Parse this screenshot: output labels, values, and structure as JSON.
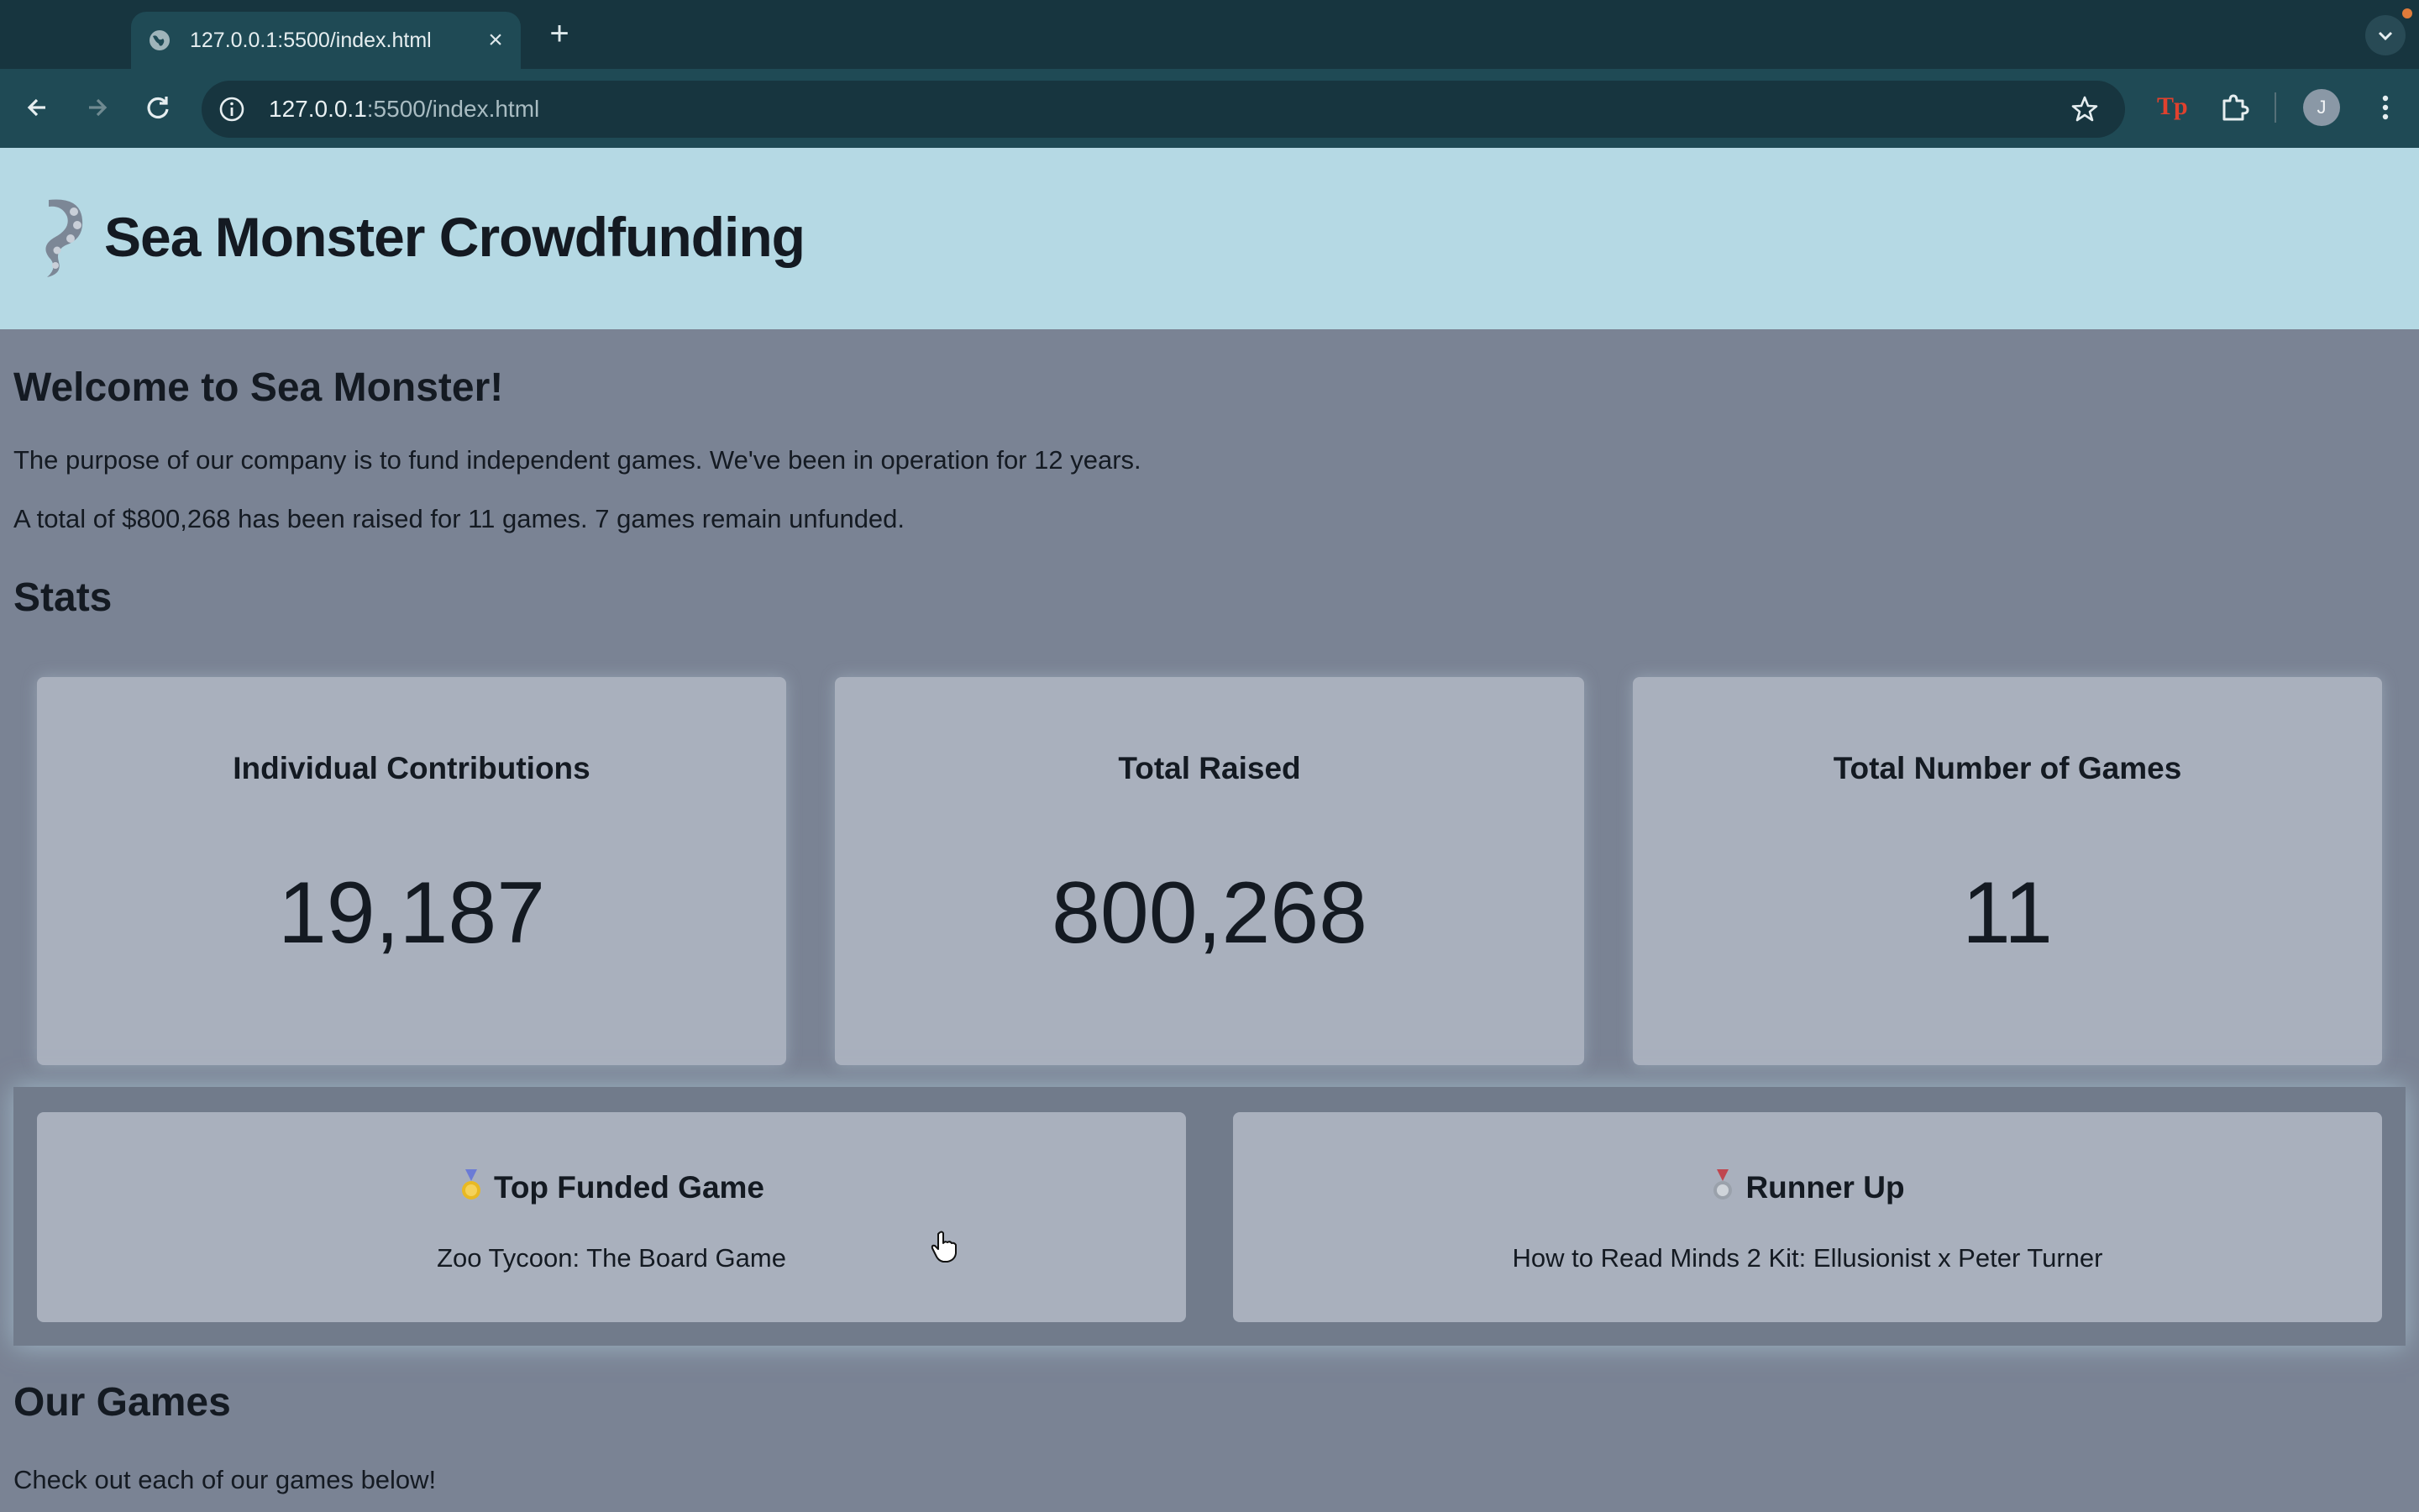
{
  "browser": {
    "tab_title": "127.0.0.1:5500/index.html",
    "url_host": "127.0.0.1",
    "url_rest": ":5500/index.html",
    "avatar_initial": "J",
    "extension_label": "Tp"
  },
  "header": {
    "title": "Sea Monster Crowdfunding"
  },
  "welcome": {
    "heading": "Welcome to Sea Monster!",
    "purpose": "The purpose of our company is to fund independent games. We've been in operation for 12 years.",
    "summary": "A total of $800,268 has been raised for 11 games. 7 games remain unfunded."
  },
  "stats": {
    "heading": "Stats",
    "cards": [
      {
        "label": "Individual Contributions",
        "value": "19,187"
      },
      {
        "label": "Total Raised",
        "value": "800,268"
      },
      {
        "label": "Total Number of Games",
        "value": "11"
      }
    ]
  },
  "top_games": {
    "top": {
      "title": "Top Funded Game",
      "name": "Zoo Tycoon: The Board Game",
      "medal": "gold-medal-icon"
    },
    "runner_up": {
      "title": "Runner Up",
      "name": "How to Read Minds 2 Kit: Ellusionist x Peter Turner",
      "medal": "silver-medal-icon"
    }
  },
  "games": {
    "heading": "Our Games",
    "subtext": "Check out each of our games below!"
  },
  "colors": {
    "chrome_dark": "#17353f",
    "chrome_toolbar": "#1f4a55",
    "header_bg": "#b5d9e4",
    "page_bg": "#7a8394",
    "card_bg": "#a9b0bd"
  }
}
